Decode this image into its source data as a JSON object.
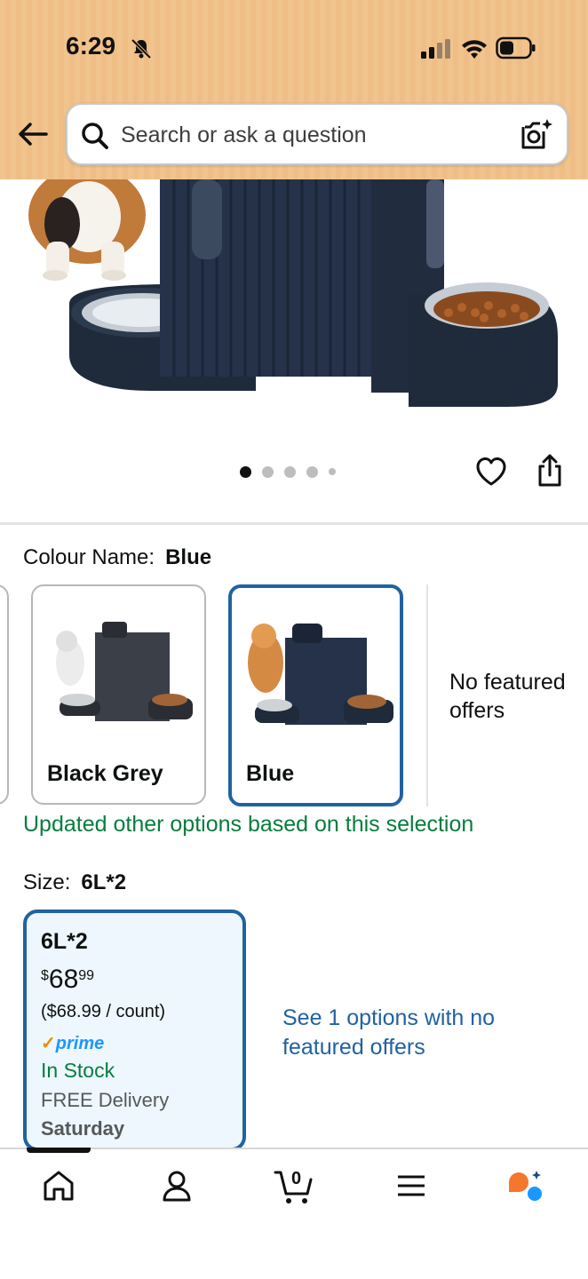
{
  "status_bar": {
    "time": "6:29"
  },
  "search": {
    "placeholder": "Search or ask a question"
  },
  "product": {
    "image_dots": 5,
    "active_dot": 1
  },
  "colour": {
    "label": "Colour Name:",
    "selected": "Blue",
    "options": [
      {
        "label": "Black Grey"
      },
      {
        "label": "Blue"
      }
    ],
    "no_featured_offers": "No featured offers",
    "update_notice": "Updated other options based on this selection"
  },
  "size": {
    "label": "Size:",
    "selected": "6L*2",
    "card": {
      "title": "6L*2",
      "price_symbol": "$",
      "price_whole": "68",
      "price_fraction": "99",
      "unit_price": "($68.99 / count)",
      "prime_label": "prime",
      "stock": "In Stock",
      "delivery": "FREE Delivery",
      "delivery_day": "Saturday"
    },
    "see_options": "See 1 options with no featured offers"
  },
  "bottom_nav": {
    "cart_count": "0"
  },
  "colors": {
    "accent_blue": "#2162a1",
    "green": "#067d3e",
    "header": "#f1c48e",
    "prime_blue": "#1a98ff"
  }
}
